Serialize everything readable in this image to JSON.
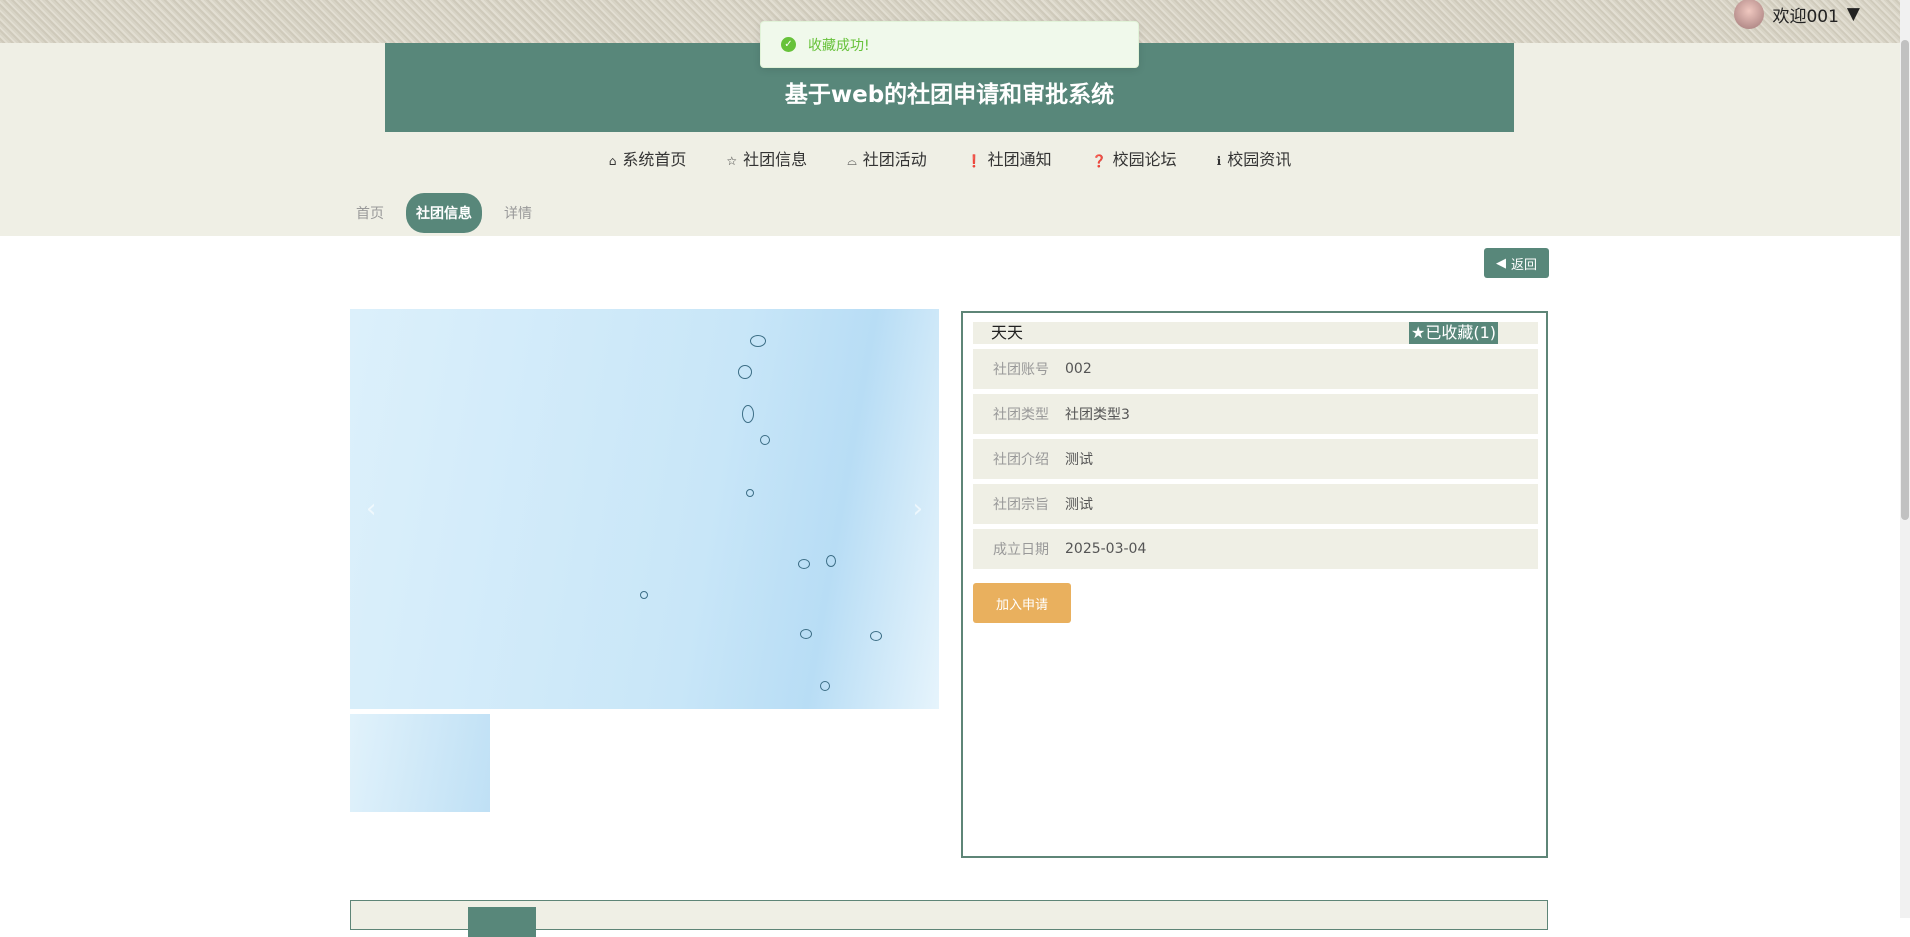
{
  "header": {
    "user_label": "欢迎001",
    "title": "基于web的社团申请和审批系统"
  },
  "toast": {
    "message": "收藏成功!"
  },
  "nav": [
    {
      "icon": "home-icon",
      "glyph": "⌂",
      "label": "系统首页"
    },
    {
      "icon": "star-icon",
      "glyph": "☆",
      "label": "社团信息"
    },
    {
      "icon": "bag-icon",
      "glyph": "⌓",
      "label": "社团活动"
    },
    {
      "icon": "alert-icon",
      "glyph": "❗",
      "label": "社团通知"
    },
    {
      "icon": "question-icon",
      "glyph": "❓",
      "label": "校园论坛"
    },
    {
      "icon": "info-icon",
      "glyph": "ℹ",
      "label": "校园资讯"
    }
  ],
  "breadcrumb": [
    "首页",
    "社团信息",
    "详情"
  ],
  "back_label": "返回",
  "detail": {
    "name": "天天",
    "favorite_label": "已收藏(1)",
    "fields": [
      {
        "label": "社团账号",
        "value": "002"
      },
      {
        "label": "社团类型",
        "value": "社团类型3"
      },
      {
        "label": "社团介绍",
        "value": "测试"
      },
      {
        "label": "社团宗旨",
        "value": "测试"
      },
      {
        "label": "成立日期",
        "value": "2025-03-04"
      }
    ],
    "join_label": "加入申请"
  }
}
